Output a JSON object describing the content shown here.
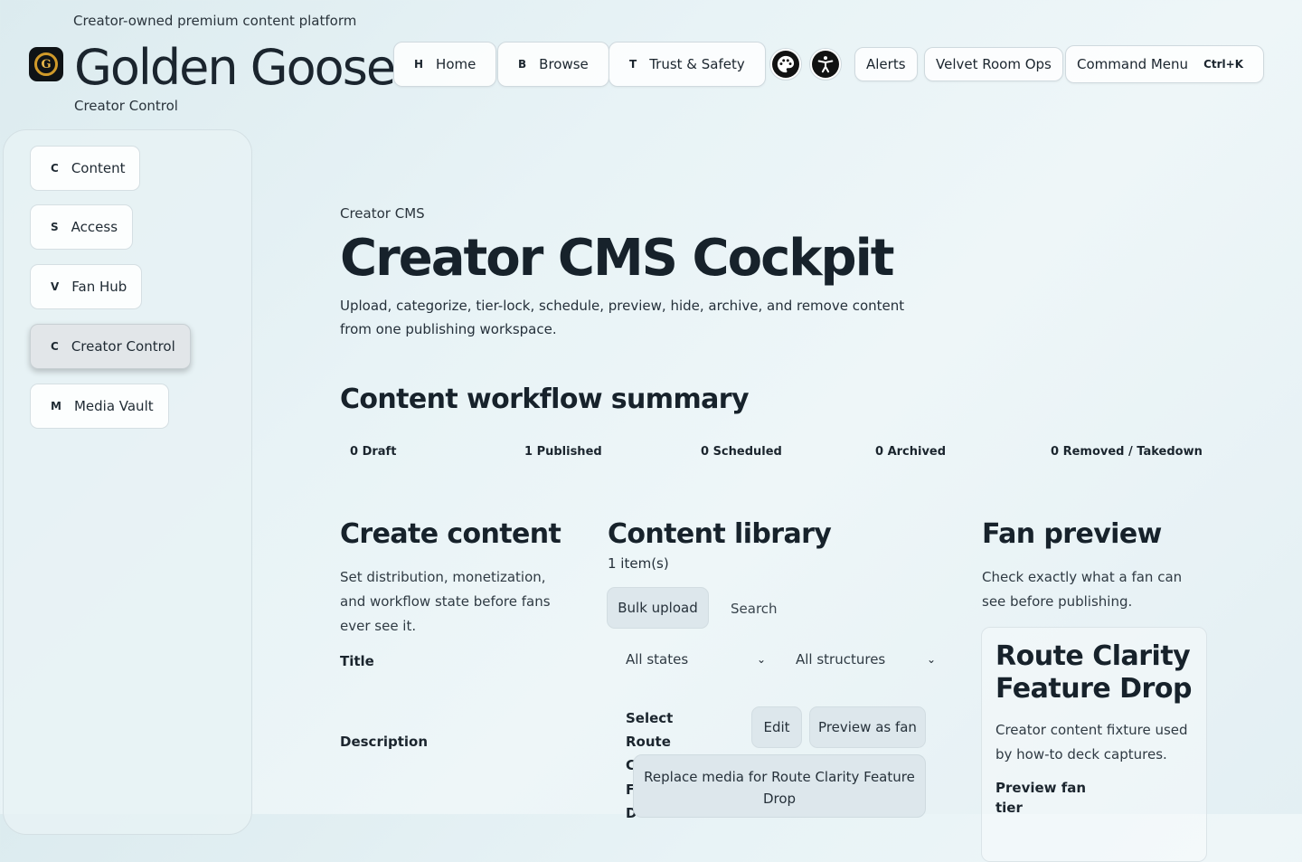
{
  "header": {
    "tagline": "Creator-owned premium content platform",
    "brand": "Golden Goose",
    "brand_sub": "Creator Control",
    "nav": [
      {
        "key": "H",
        "label": "Home"
      },
      {
        "key": "B",
        "label": "Browse"
      },
      {
        "key": "T",
        "label": "Trust & Safety"
      }
    ],
    "alerts": "Alerts",
    "ops": "Velvet Room Ops",
    "command_menu": "Command Menu",
    "shortcut": "Ctrl+K",
    "icons": {
      "theme": "palette-icon",
      "accessibility": "accessibility-icon"
    }
  },
  "sidebar": {
    "items": [
      {
        "key": "C",
        "label": "Content"
      },
      {
        "key": "S",
        "label": "Access"
      },
      {
        "key": "V",
        "label": "Fan Hub"
      },
      {
        "key": "C",
        "label": "Creator Control",
        "active": true
      },
      {
        "key": "M",
        "label": "Media Vault"
      }
    ]
  },
  "main": {
    "breadcrumb": "Creator CMS",
    "title": "Creator CMS Cockpit",
    "lead": "Upload, categorize, tier-lock, schedule, preview, hide, archive, and remove content from one publishing workspace.",
    "summary_title": "Content workflow summary",
    "stats": [
      "0 Draft",
      "1 Published",
      "0 Scheduled",
      "0 Archived",
      "0 Removed / Takedown"
    ]
  },
  "create": {
    "title": "Create content",
    "desc": "Set distribution, monetization, and workflow state before fans ever see it.",
    "title_label": "Title",
    "description_label": "Description"
  },
  "library": {
    "title": "Content library",
    "count": "1 item(s)",
    "bulk_upload": "Bulk upload",
    "search_placeholder": "Search",
    "filter_state": "All states",
    "filter_structure": "All structures",
    "select_label_1": "Select",
    "select_label_2": "Route",
    "select_label_3": "C",
    "select_label_4": "F",
    "select_label_5": "D",
    "edit": "Edit",
    "preview_as_fan": "Preview as fan",
    "tooltip": "Replace media for Route Clarity Feature Drop"
  },
  "preview": {
    "title": "Fan preview",
    "desc": "Check exactly what a fan can see before publishing.",
    "card_title": "Route Clarity Feature Drop",
    "card_desc": "Creator content fixture used by how-to deck captures.",
    "tier_label_1": "Preview fan",
    "tier_label_2": "tier"
  }
}
